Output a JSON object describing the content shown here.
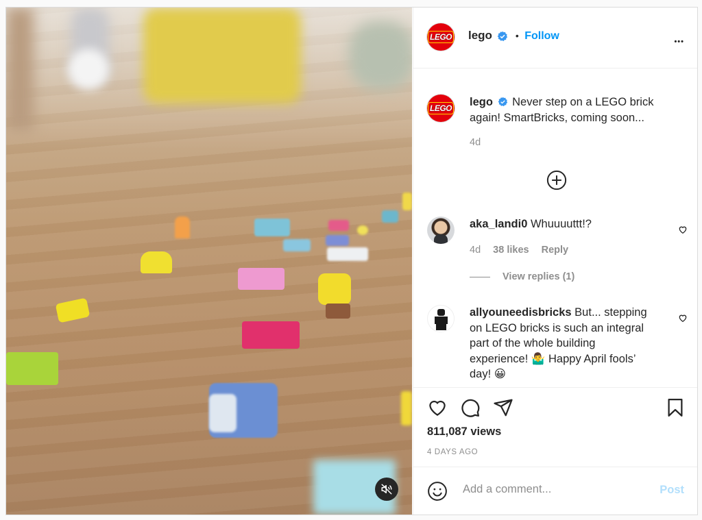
{
  "post": {
    "username": "lego",
    "follow_label": "Follow",
    "separator": "•",
    "more_label": "•••",
    "logo_text": "LEGO"
  },
  "caption": {
    "username": "lego",
    "text": "Never step on a LEGO brick again! SmartBricks, coming soon...",
    "age": "4d"
  },
  "comments": [
    {
      "username": "aka_landi0",
      "text": "Whuuuuttt!?",
      "age": "4d",
      "likes": "38 likes",
      "reply_label": "Reply"
    },
    {
      "username": "allyouneedisbricks",
      "text": "But... stepping on LEGO bricks is such an integral part of the whole building experience! 🤷‍♂️ Happy April fools’ day! 😀"
    }
  ],
  "view_replies": "View replies (1)",
  "stats": {
    "views": "811,087 views",
    "date": "4 DAYS AGO"
  },
  "add_comment": {
    "placeholder": "Add a comment...",
    "post_label": "Post"
  },
  "colors": {
    "accent": "#0095f6",
    "post_disabled": "#b2dffc",
    "lego_red": "#e3000b"
  }
}
